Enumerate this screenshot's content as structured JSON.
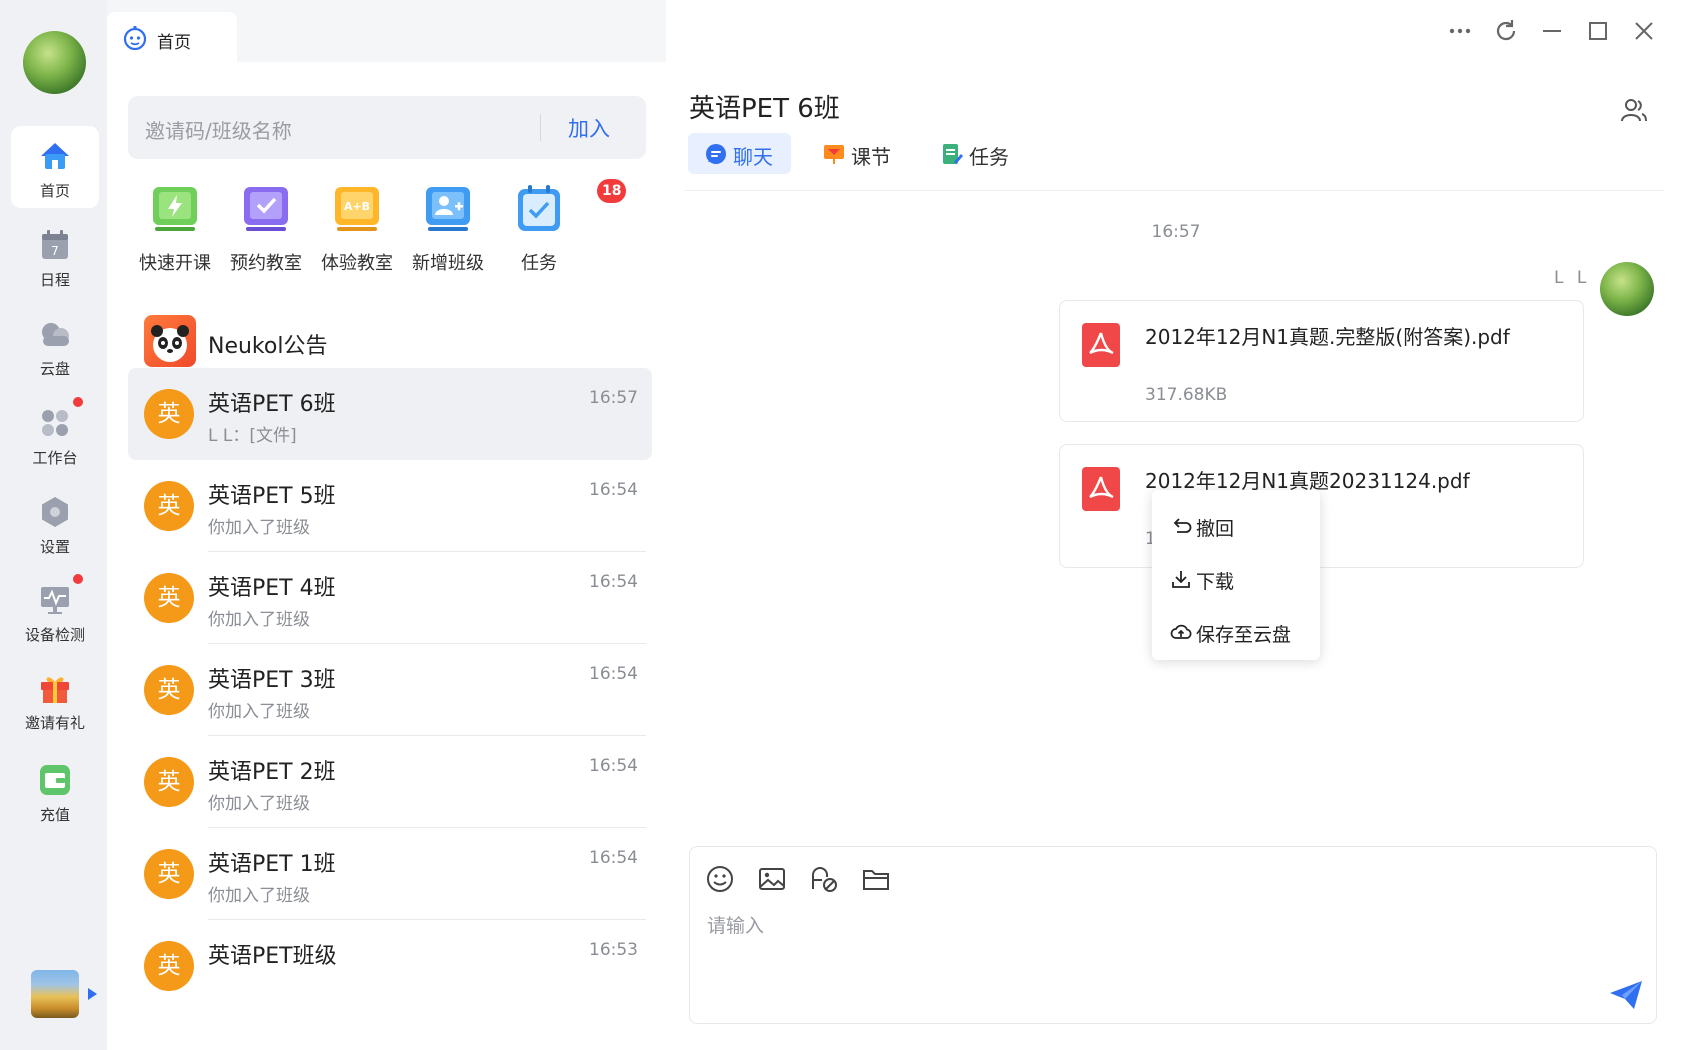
{
  "home_tab": {
    "label": "首页"
  },
  "nav": {
    "items": [
      {
        "label": "首页",
        "icon": "home-icon",
        "active": true
      },
      {
        "label": "日程",
        "icon": "calendar-icon",
        "day": "7"
      },
      {
        "label": "云盘",
        "icon": "cloud-icon"
      },
      {
        "label": "工作台",
        "icon": "workbench-icon",
        "dot": true
      },
      {
        "label": "设置",
        "icon": "settings-icon"
      },
      {
        "label": "设备检测",
        "icon": "device-check-icon",
        "dot": true
      },
      {
        "label": "邀请有礼",
        "icon": "gift-icon"
      },
      {
        "label": "充值",
        "icon": "wallet-icon"
      }
    ]
  },
  "join": {
    "placeholder": "邀请码/班级名称",
    "button": "加入"
  },
  "quick_actions": [
    {
      "label": "快速开课",
      "icon": "quick-class-icon",
      "ab": ""
    },
    {
      "label": "预约教室",
      "icon": "book-room-icon",
      "ab": ""
    },
    {
      "label": "体验教室",
      "icon": "trial-room-icon",
      "ab": "A+B"
    },
    {
      "label": "新增班级",
      "icon": "add-class-icon",
      "ab": ""
    },
    {
      "label": "任务",
      "icon": "task-icon",
      "badge": "18"
    }
  ],
  "notice": {
    "name": "Neukol公告"
  },
  "conversations": [
    {
      "avatar": "英",
      "name": "英语PET 6班",
      "sub": "L L：[文件]",
      "time": "16:57",
      "active": true
    },
    {
      "avatar": "英",
      "name": "英语PET 5班",
      "sub": "你加入了班级",
      "time": "16:54"
    },
    {
      "avatar": "英",
      "name": "英语PET 4班",
      "sub": "你加入了班级",
      "time": "16:54"
    },
    {
      "avatar": "英",
      "name": "英语PET 3班",
      "sub": "你加入了班级",
      "time": "16:54"
    },
    {
      "avatar": "英",
      "name": "英语PET 2班",
      "sub": "你加入了班级",
      "time": "16:54"
    },
    {
      "avatar": "英",
      "name": "英语PET 1班",
      "sub": "你加入了班级",
      "time": "16:54"
    },
    {
      "avatar": "英",
      "name": "英语PET班级",
      "sub": "",
      "time": "16:53"
    }
  ],
  "chat": {
    "title": "英语PET 6班",
    "tabs": [
      {
        "label": "聊天",
        "icon": "chat-bubble-icon",
        "active": true
      },
      {
        "label": "课节",
        "icon": "lesson-flag-icon"
      },
      {
        "label": "任务",
        "icon": "task-doc-icon"
      }
    ],
    "time_divider": "16:57",
    "sender": "L L",
    "files": [
      {
        "name": "2012年12月N1真题.完整版(附答案).pdf",
        "size": "317.68KB"
      },
      {
        "name": "2012年12月N1真题20231124.pdf",
        "size": "1"
      }
    ],
    "context_menu": [
      {
        "label": "撤回",
        "icon": "undo-icon"
      },
      {
        "label": "下载",
        "icon": "download-icon"
      },
      {
        "label": "保存至云盘",
        "icon": "cloud-upload-icon"
      }
    ],
    "composer": {
      "placeholder": "请输入"
    }
  },
  "colors": {
    "accent": "#2f6ff0",
    "orange": "#f49a18",
    "badge": "#f23b3b"
  }
}
